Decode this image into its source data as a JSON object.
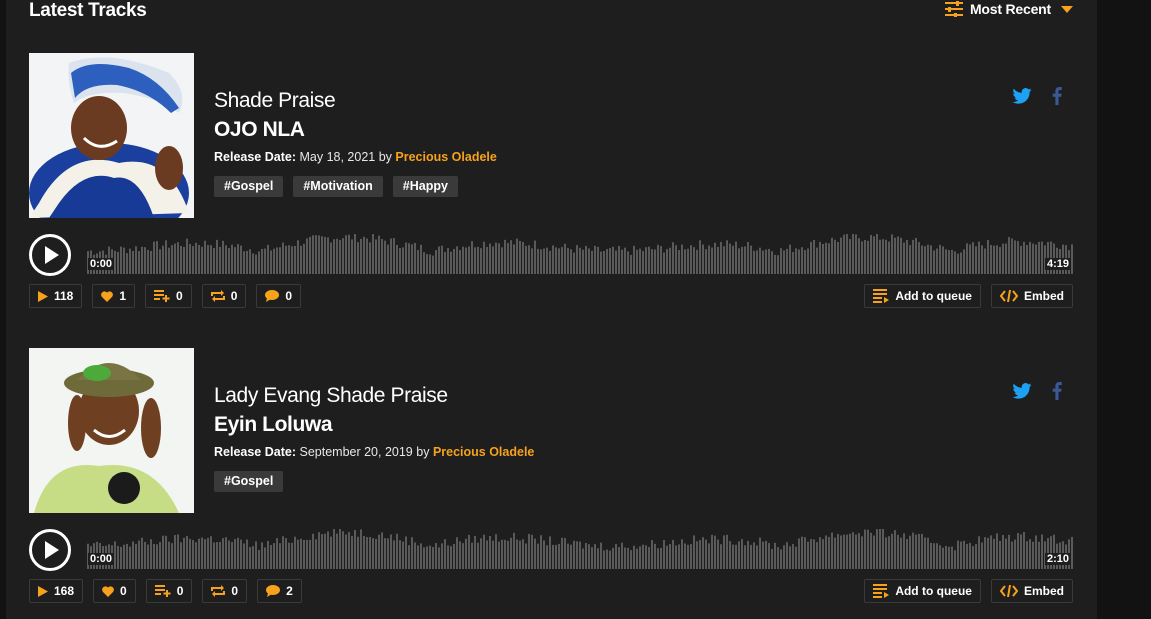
{
  "header": {
    "title": "Latest Tracks",
    "sort_label": "Most Recent"
  },
  "colors": {
    "accent": "#f6a21c",
    "twitter": "#1da1f2",
    "facebook": "#3b5998",
    "wave": "#5a5a5a"
  },
  "tracks": [
    {
      "artist": "Shade Praise",
      "title": "OJO NLA",
      "release_label": "Release Date:",
      "release_date": "May 18, 2021",
      "by": "by",
      "uploader": "Precious Oladele",
      "tags": [
        "#Gospel",
        "#Motivation",
        "#Happy"
      ],
      "time_start": "0:00",
      "duration": "4:19",
      "plays": "118",
      "likes": "1",
      "playlists": "0",
      "reposts": "0",
      "comments": "0",
      "queue_label": "Add to queue",
      "embed_label": "Embed"
    },
    {
      "artist": "Lady Evang Shade Praise",
      "title": "Eyin Loluwa",
      "release_label": "Release Date:",
      "release_date": "September 20, 2019",
      "by": "by",
      "uploader": "Precious Oladele",
      "tags": [
        "#Gospel"
      ],
      "time_start": "0:00",
      "duration": "2:10",
      "plays": "168",
      "likes": "0",
      "playlists": "0",
      "reposts": "0",
      "comments": "2",
      "queue_label": "Add to queue",
      "embed_label": "Embed"
    }
  ]
}
